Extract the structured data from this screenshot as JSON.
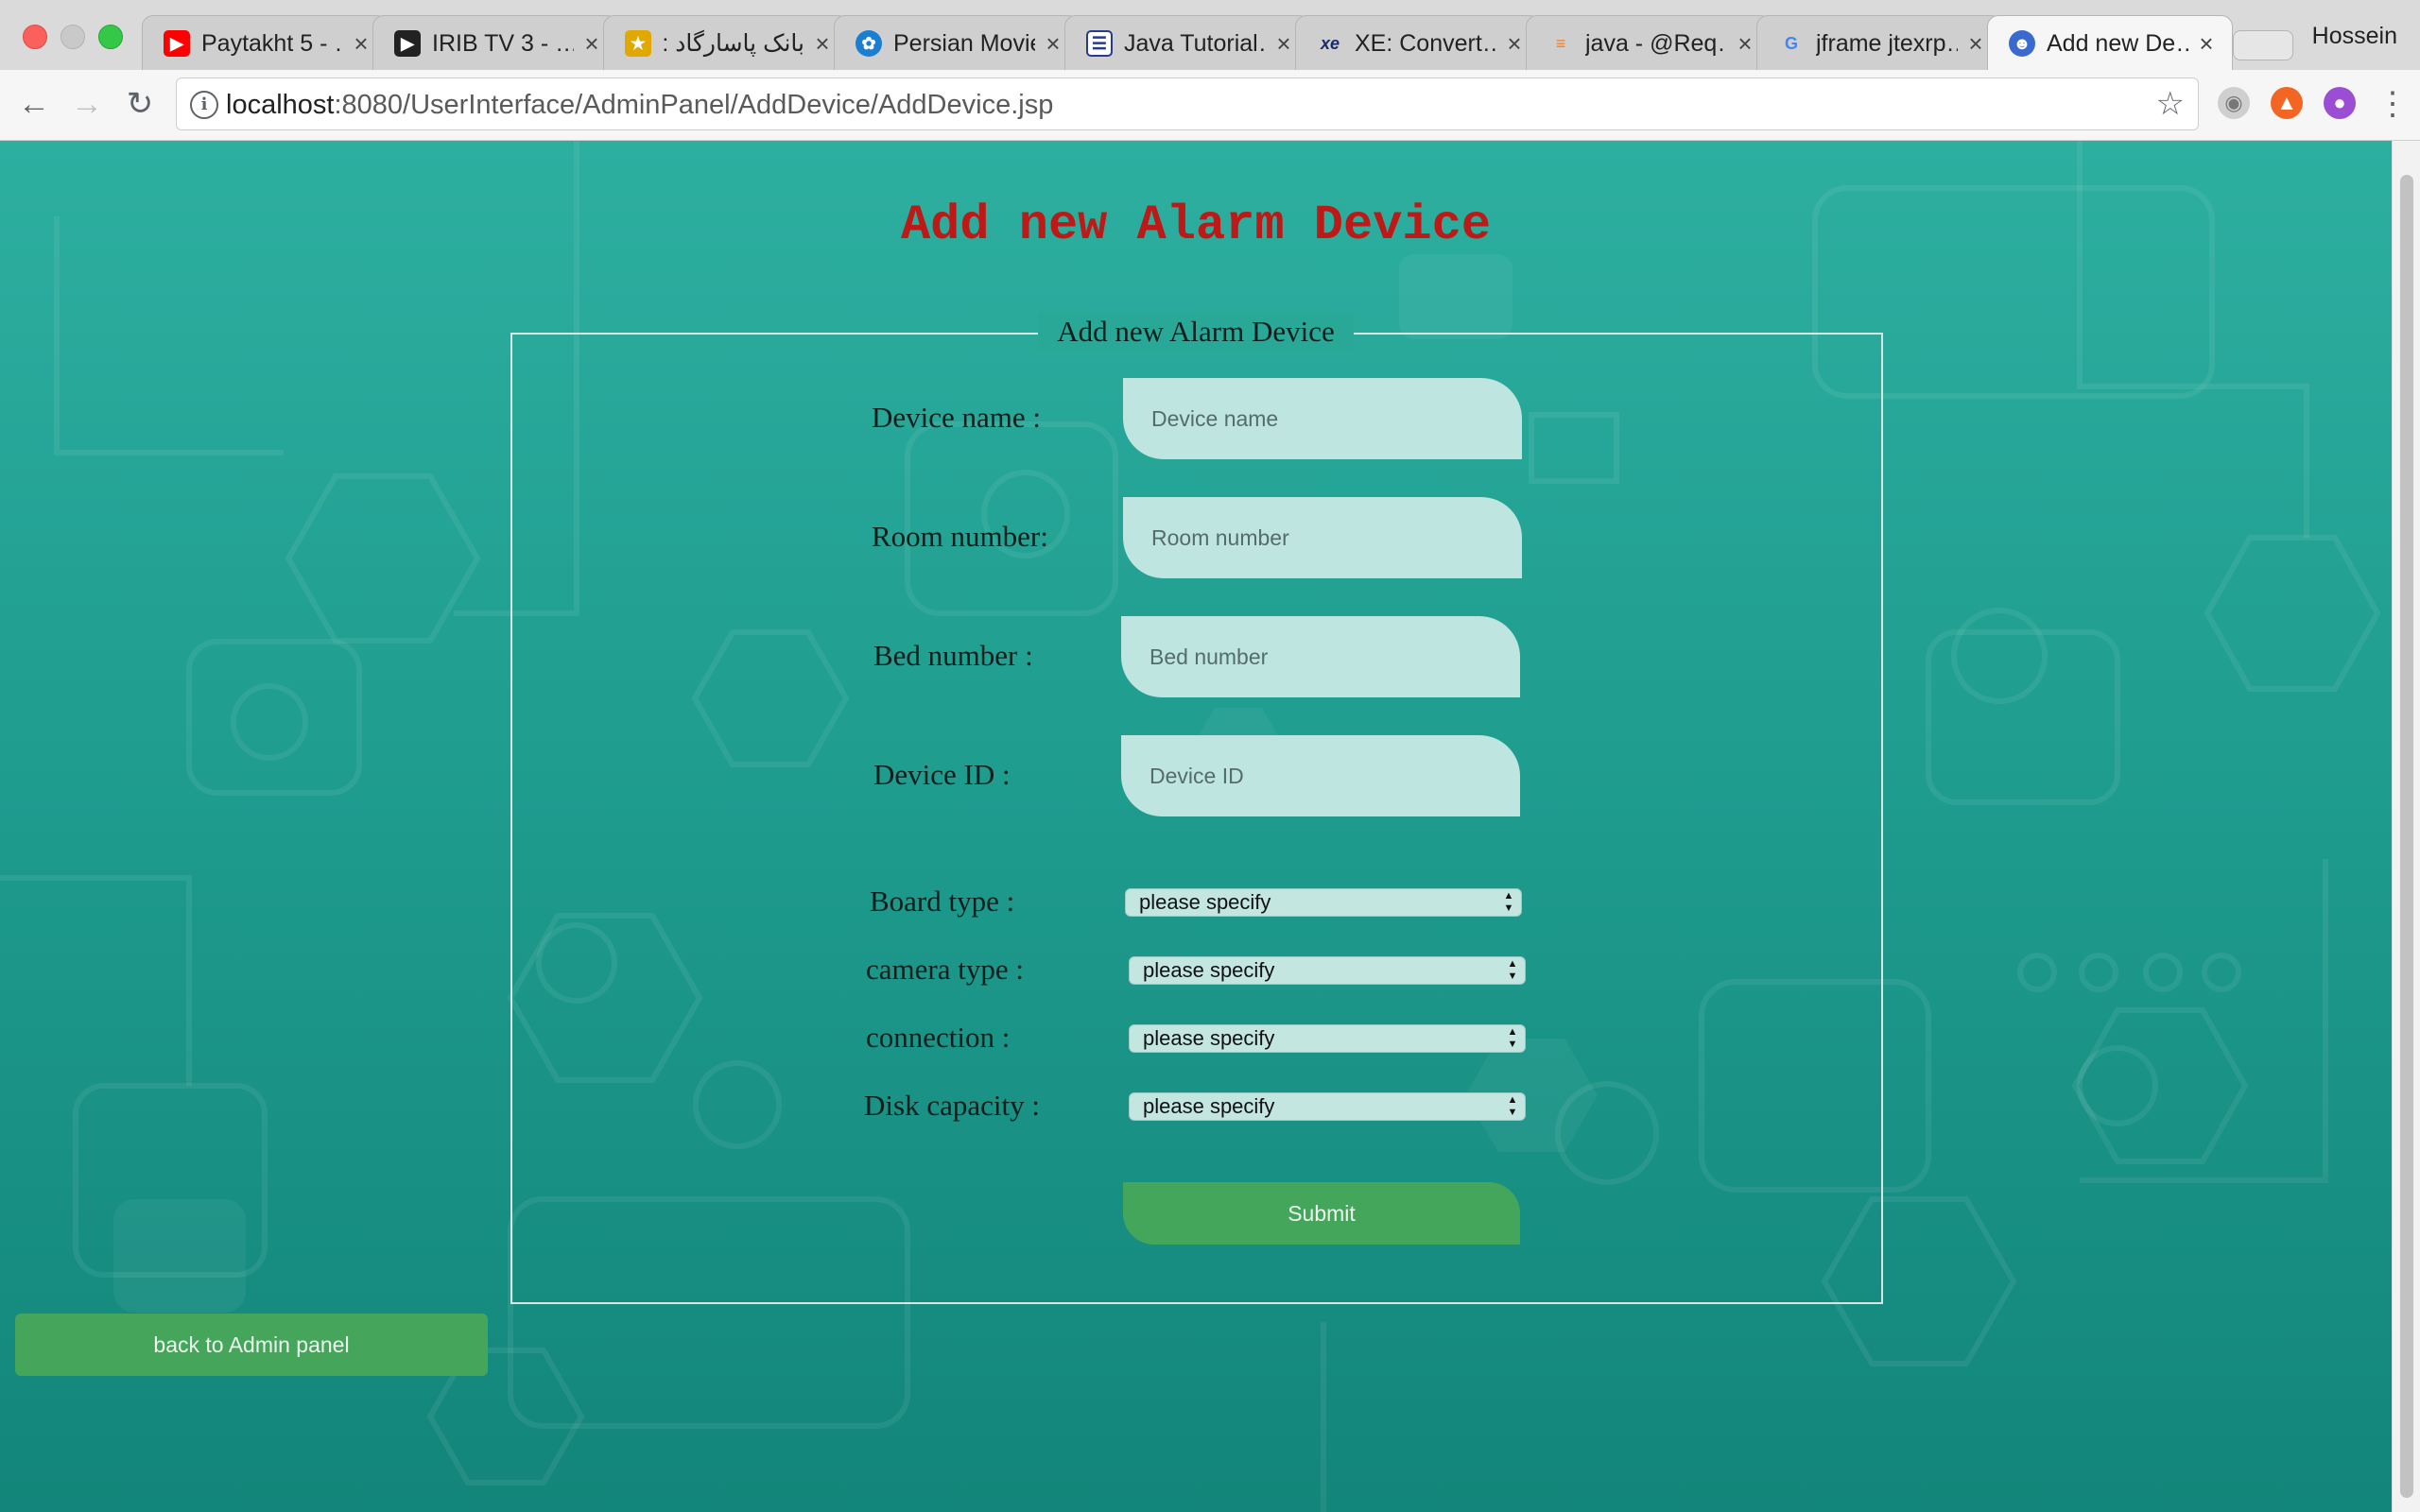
{
  "browser": {
    "tabs": [
      {
        "title": "Paytakht 5 - …",
        "icon": "youtube-icon",
        "color": "#ff0000"
      },
      {
        "title": "IRIB TV 3 - …",
        "icon": "play-icon",
        "color": "#222222"
      },
      {
        "title": "بانک پاسارگاد :: …",
        "icon": "bank-icon",
        "color": "#e0a800"
      },
      {
        "title": "Persian Movie…",
        "icon": "bird-icon",
        "color": "#1a7fd0"
      },
      {
        "title": "Java Tutorial…",
        "icon": "tutorial-icon",
        "color": "#2a3a8a"
      },
      {
        "title": "XE: Convert…",
        "icon": "xe-icon",
        "color": "#1a2a6a"
      },
      {
        "title": "java - @Req…",
        "icon": "stackoverflow-icon",
        "color": "#f48024"
      },
      {
        "title": "jframe jtexrp…",
        "icon": "google-icon",
        "color": "#4285f4"
      },
      {
        "title": "Add new De…",
        "icon": "admin-user-icon",
        "color": "#3a6ad0",
        "active": true
      }
    ],
    "profile_name": "Hossein",
    "url_host": "localhost",
    "url_path": ":8080/UserInterface/AdminPanel/AddDevice/AddDevice.jsp"
  },
  "page": {
    "title": "Add new Alarm Device",
    "legend": "Add new Alarm Device",
    "fields": {
      "device_name": {
        "label": "Device name :",
        "placeholder": "Device name",
        "value": ""
      },
      "room_number": {
        "label": "Room number:",
        "placeholder": "Room number",
        "value": ""
      },
      "bed_number": {
        "label": "Bed number :",
        "placeholder": "Bed number",
        "value": ""
      },
      "device_id": {
        "label": "Device ID :",
        "placeholder": "Device ID",
        "value": ""
      }
    },
    "selects": {
      "board_type": {
        "label": "Board type :",
        "value": "please specify"
      },
      "camera_type": {
        "label": "camera type :",
        "value": "please specify"
      },
      "connection": {
        "label": "connection :",
        "value": "please specify"
      },
      "disk_capacity": {
        "label": "Disk capacity :",
        "value": "please specify"
      }
    },
    "submit_label": "Submit",
    "back_label": "back to Admin panel"
  },
  "colors": {
    "title": "#bd1a17",
    "background_top": "#2dafa0",
    "background_bottom": "#13857a",
    "button": "#44a65a"
  }
}
